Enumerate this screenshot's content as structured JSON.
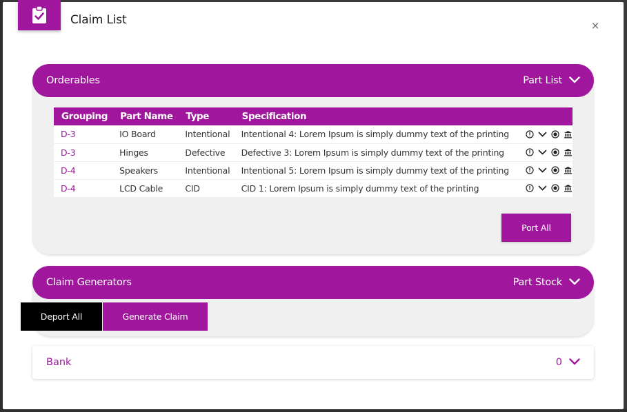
{
  "modal": {
    "title": "Claim List",
    "close_symbol": "×",
    "header_icon": "clipboard-check-icon"
  },
  "orderables": {
    "title": "Orderables",
    "right_label": "Part List",
    "columns": [
      "Grouping",
      "Part Name",
      "Type",
      "Specification"
    ],
    "rows": [
      {
        "grouping": "D-3",
        "part_name": "IO Board",
        "type": "Intentional",
        "specification": "Intentional 4: Lorem Ipsum is simply dummy text of the printing"
      },
      {
        "grouping": "D-3",
        "part_name": "Hinges",
        "type": "Defective",
        "specification": "Defective 3: Lorem Ipsum is simply dummy text of the printing"
      },
      {
        "grouping": "D-4",
        "part_name": "Speakers",
        "type": "Intentional",
        "specification": "Intentional 5: Lorem Ipsum is simply dummy text of the printing"
      },
      {
        "grouping": "D-4",
        "part_name": "LCD Cable",
        "type": "CID",
        "specification": "CID 1: Lorem Ipsum is simply dummy text of the printing"
      }
    ],
    "row_action_icons": [
      "info-icon",
      "chevron-down-icon",
      "radio-icon",
      "bank-icon"
    ],
    "port_all_label": "Port All"
  },
  "generators": {
    "title": "Claim Generators",
    "right_label": "Part Stock",
    "deport_all_label": "Deport All",
    "generate_claim_label": "Generate Claim"
  },
  "bank": {
    "title": "Bank",
    "count": "0"
  },
  "colors": {
    "accent": "#a0179e",
    "panel": "#f0f0f0",
    "dark_button": "#000000"
  }
}
